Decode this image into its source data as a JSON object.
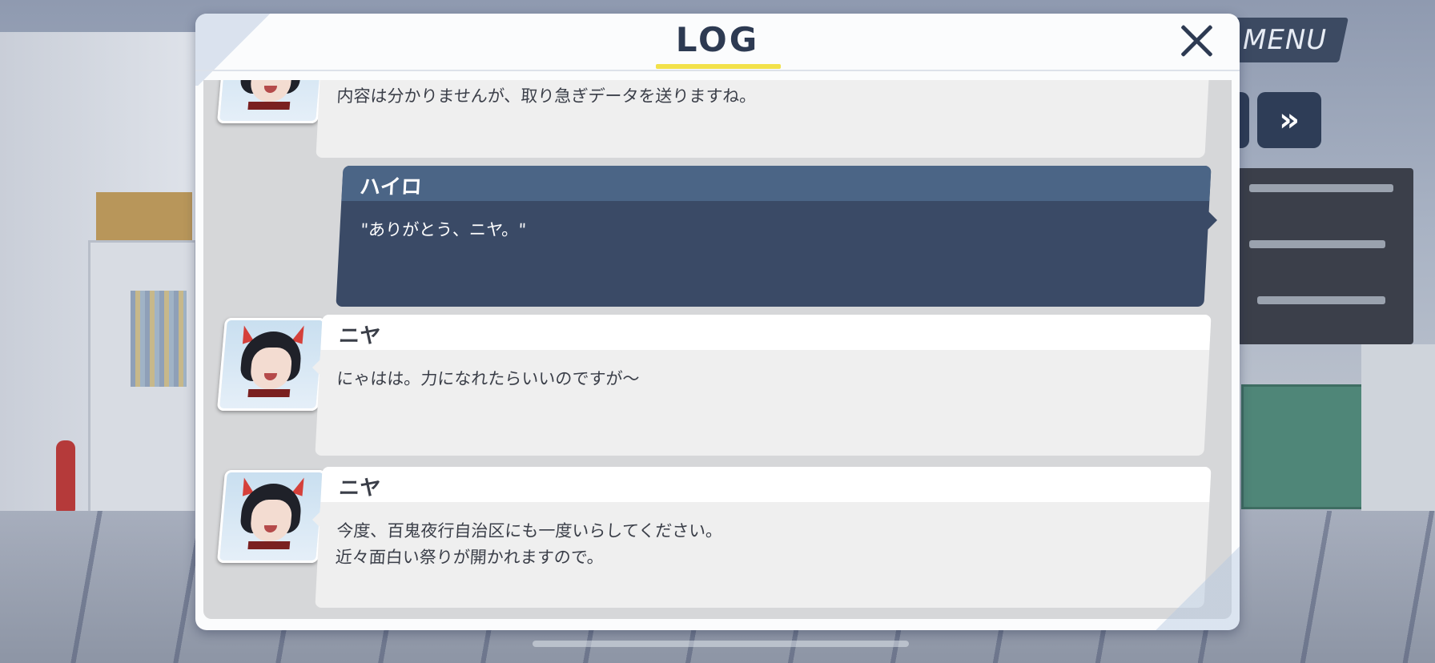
{
  "hud": {
    "menu_label": "MENU",
    "skip_label": "»"
  },
  "log_dialog": {
    "title": "LOG",
    "close_icon": "close-x-icon",
    "entries": [
      {
        "speaker": "",
        "text": "内容は分かりませんが、取り急ぎデータを送りますね。",
        "style": "light",
        "has_portrait": true
      },
      {
        "speaker": "ハイロ",
        "text": "\"ありがとう、ニヤ。\"",
        "style": "dark",
        "has_portrait": false
      },
      {
        "speaker": "ニヤ",
        "text": "にゃはは。力になれたらいいのですが～",
        "style": "light",
        "has_portrait": true
      },
      {
        "speaker": "ニヤ",
        "text": "今度、百鬼夜行自治区にも一度いらしてください。\n近々面白い祭りが開かれますので。",
        "style": "light",
        "has_portrait": true
      }
    ]
  },
  "colors": {
    "title_text": "#2d3a52",
    "title_underline": "#f2e14a",
    "player_bubble": "#3a4a66",
    "player_name_bar": "#4b6586",
    "npc_bubble": "#efefef"
  }
}
